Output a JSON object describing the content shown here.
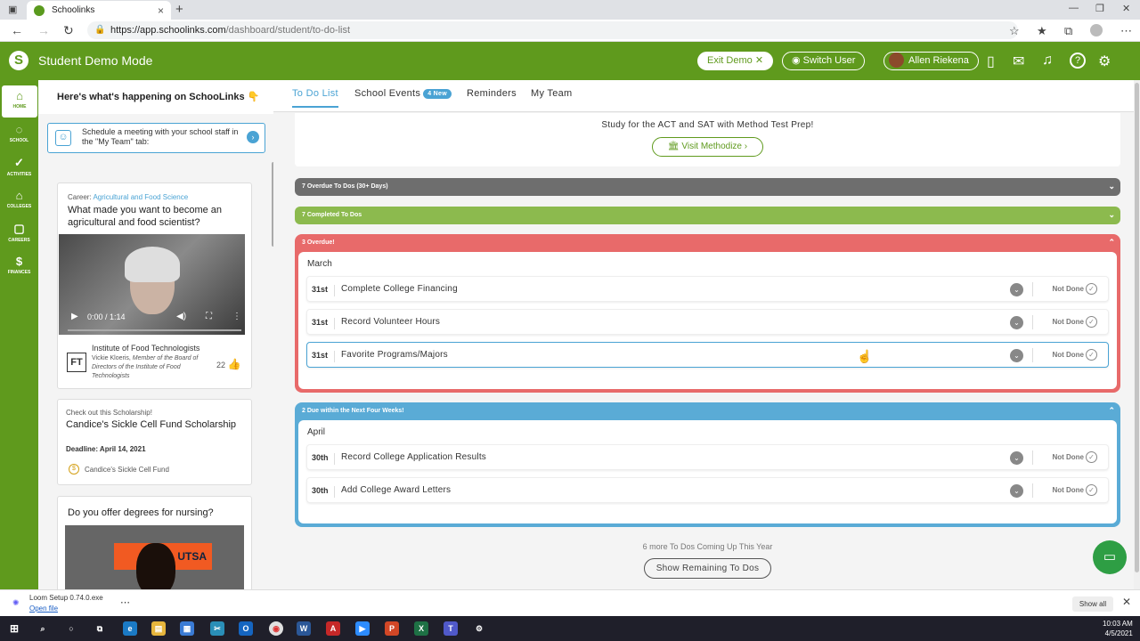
{
  "browser": {
    "tab_title": "Schoolinks",
    "url_host": "https://app.schoolinks.com",
    "url_path": "/dashboard/student/to-do-list"
  },
  "header": {
    "title": "Student Demo Mode",
    "exit_demo": "Exit Demo",
    "switch_user": "Switch User",
    "user_name": "Allen Riekena",
    "brand_color": "#5f9a1d"
  },
  "leftnav": {
    "items": [
      {
        "label": "HOME",
        "icon": "home-icon"
      },
      {
        "label": "SCHOOL",
        "icon": "apple-icon"
      },
      {
        "label": "ACTIVITIES",
        "icon": "check-circle-icon"
      },
      {
        "label": "COLLEGES",
        "icon": "building-icon"
      },
      {
        "label": "CAREERS",
        "icon": "briefcase-icon"
      },
      {
        "label": "FINANCES",
        "icon": "money-bag-icon"
      }
    ]
  },
  "feed": {
    "heading": "Here's what's happening on SchooLinks 👇",
    "meeting_text": "Schedule a meeting with your school staff in the \"My Team\" tab:",
    "career_card": {
      "career_prefix": "Career: ",
      "career_name": "Agricultural and Food Science",
      "question": "What made you want to become an agricultural and food scientist?",
      "video_time": "0:00 / 1:14",
      "org": "Institute of Food Technologists",
      "person": "Vickie Kloeris,",
      "person_role": "Member of the Board of Directors of the Institute of Food Technologists",
      "likes": "22"
    },
    "scholarship_card": {
      "label": "Check out this Scholarship!",
      "title": "Candice's Sickle Cell Fund Scholarship",
      "deadline": "Deadline: April 14, 2021",
      "fund": "Candice's Sickle Cell Fund"
    },
    "nursing_card": {
      "question": "Do you offer degrees for nursing?",
      "sign_text": "UTSA"
    }
  },
  "main": {
    "tabs": [
      {
        "label": "To Do List",
        "active": true
      },
      {
        "label": "School Events",
        "badge": "4 New"
      },
      {
        "label": "Reminders"
      },
      {
        "label": "My Team"
      }
    ],
    "promo_text": "Study for the ACT and SAT with Method Test Prep!",
    "promo_button": "Visit Methodize",
    "overdue_30": "7 Overdue To Dos (30+ Days)",
    "completed": "7 Completed To Dos",
    "overdue_section": {
      "title": "3 Overdue!",
      "month": "March",
      "color": "#e86a6a",
      "rows": [
        {
          "day": "31st",
          "title": "Complete College Financing",
          "status": "Not Done"
        },
        {
          "day": "31st",
          "title": "Record Volunteer Hours",
          "status": "Not Done"
        },
        {
          "day": "31st",
          "title": "Favorite Programs/Majors",
          "status": "Not Done"
        }
      ]
    },
    "due_section": {
      "title": "2 Due within the Next Four Weeks!",
      "month": "April",
      "color": "#5aabd6",
      "rows": [
        {
          "day": "30th",
          "title": "Record College Application Results",
          "status": "Not Done"
        },
        {
          "day": "30th",
          "title": "Add College Award Letters",
          "status": "Not Done"
        }
      ]
    },
    "more_text": "6 more To Dos Coming Up This Year",
    "more_button": "Show Remaining To Dos"
  },
  "download": {
    "file": "Loom Setup 0.74.0.exe",
    "open": "Open file",
    "show_all": "Show all"
  },
  "taskbar": {
    "time": "10:03 AM",
    "date": "4/5/2021"
  }
}
